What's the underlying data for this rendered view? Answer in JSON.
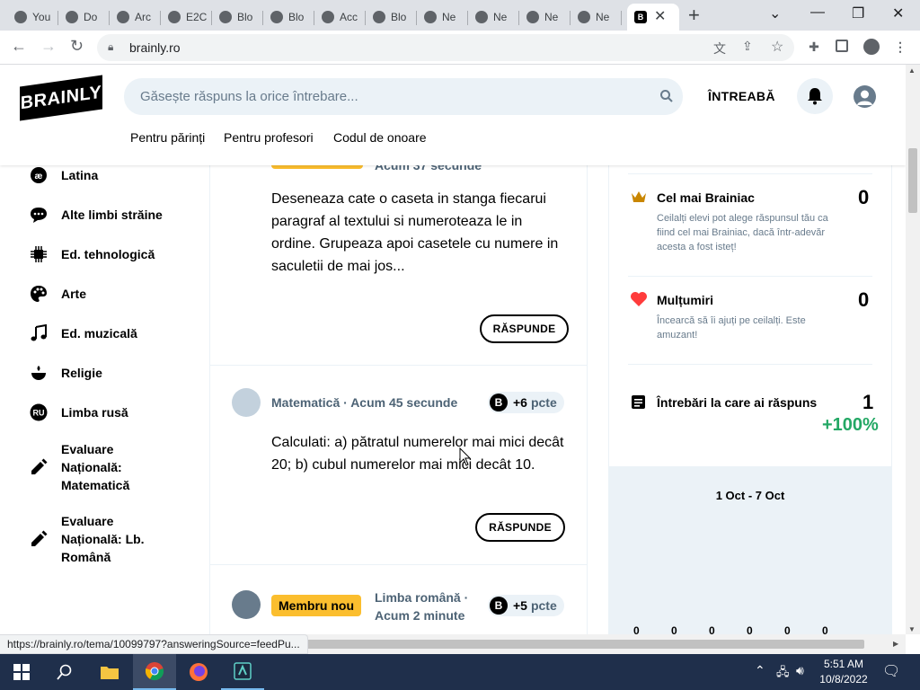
{
  "browser": {
    "tabs": [
      {
        "label": "You",
        "icon": "google-icon"
      },
      {
        "label": "Do",
        "icon": "docs-icon"
      },
      {
        "label": "Arc",
        "icon": "page-icon"
      },
      {
        "label": "E2C",
        "icon": "globe-icon"
      },
      {
        "label": "Blo",
        "icon": "globe-icon"
      },
      {
        "label": "Blo",
        "icon": "globe-icon"
      },
      {
        "label": "Acc",
        "icon": "globe-icon"
      },
      {
        "label": "Blo",
        "icon": "globe-icon"
      },
      {
        "label": "Ne",
        "icon": "notion-icon"
      },
      {
        "label": "Ne",
        "icon": "notion-icon"
      },
      {
        "label": "Ne",
        "icon": "notion-icon"
      },
      {
        "label": "Ne",
        "icon": "notion-icon"
      }
    ],
    "active_tab_icon": "brainly-icon",
    "url": "brainly.ro",
    "status_url": "https://brainly.ro/tema/10099797?answeringSource=feedPu..."
  },
  "header": {
    "logo": "BRAINLY",
    "search_placeholder": "Găsește răspuns la orice întrebare...",
    "ask_label": "ÎNTREABĂ",
    "links": [
      "Pentru părinți",
      "Pentru profesori",
      "Codul de onoare"
    ]
  },
  "sidebar": {
    "items": [
      {
        "label": "Latina",
        "icon": "latin-icon"
      },
      {
        "label": "Alte limbi străine",
        "icon": "chat-bubble-icon"
      },
      {
        "label": "Ed. tehnologică",
        "icon": "chip-icon"
      },
      {
        "label": "Arte",
        "icon": "palette-icon"
      },
      {
        "label": "Ed. muzicală",
        "icon": "music-note-icon"
      },
      {
        "label": "Religie",
        "icon": "religion-icon"
      },
      {
        "label": "Limba rusă",
        "icon": "ru-badge-icon"
      },
      {
        "label": "Evaluare Națională: Matematică",
        "icon": "pencil-icon"
      },
      {
        "label": "Evaluare Națională: Lb. Română",
        "icon": "pencil-icon"
      }
    ]
  },
  "feed": {
    "questions": [
      {
        "meta_time": "Acum 37 secunde",
        "text": "Deseneaza cate o caseta in stanga fiecarui paragraf al textului si numeroteaza le in ordine. Grupeaza apoi casetele cu numere in saculetii de mai jos...",
        "answer_label": "RĂSPUNDE"
      },
      {
        "subject": "Matematică",
        "time": "Acum 45 secunde",
        "points": "+6",
        "points_unit": "pcte",
        "text": "Calculati: a) pătratul numerelor mai mici decât 20; b) cubul numerelor mai mici decât 10.",
        "answer_label": "RĂSPUNDE"
      },
      {
        "badge": "Membru nou",
        "subject": "Limba română",
        "time": "Acum 2 minute",
        "points": "+5",
        "points_unit": "pcte"
      }
    ]
  },
  "stats": {
    "brainiac": {
      "title": "Cel mai Brainiac",
      "desc": "Ceilalți elevi pot alege răspunsul tău ca fiind cel mai Brainiac, dacă într-adevăr acesta a fost isteț!",
      "value": "0"
    },
    "thanks": {
      "title": "Mulțumiri",
      "desc": "Încearcă să îi ajuți pe ceilalți. Este amuzant!",
      "value": "0"
    },
    "answered": {
      "title": "Întrebări la care ai răspuns",
      "value": "1",
      "change": "+100%",
      "change_color": "#24a865"
    },
    "date_range": "1 Oct - 7 Oct",
    "chart_zeros": [
      "0",
      "0",
      "0",
      "0",
      "0",
      "0"
    ]
  },
  "taskbar": {
    "time": "5:51 AM",
    "date": "10/8/2022"
  },
  "colors": {
    "accent_yellow": "#fbbe2e",
    "heart_red": "#ff3b3b",
    "crown_gold": "#c98600",
    "green": "#24a865"
  }
}
